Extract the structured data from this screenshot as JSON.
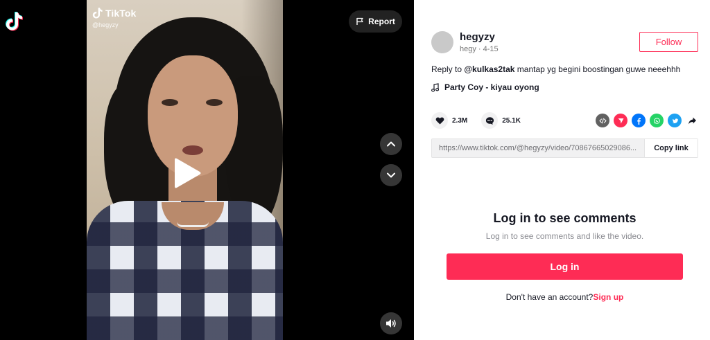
{
  "app": {
    "logo_icon": "tiktok-logo-icon"
  },
  "video": {
    "watermark_brand": "TikTok",
    "watermark_handle": "@hegyzy",
    "report_label": "Report",
    "is_paused": true
  },
  "author": {
    "username": "hegyzy",
    "nickname": "hegy",
    "separator": " · ",
    "date": "4-15",
    "follow_label": "Follow"
  },
  "caption": {
    "prefix": "Reply to ",
    "mention": "@kulkas2tak",
    "text": " mantap yg begini boostingan guwe neeehhh"
  },
  "music": {
    "title": "Party Coy - kiyau oyong"
  },
  "stats": {
    "likes": "2.3M",
    "comments": "25.1K"
  },
  "share": {
    "icons": [
      "embed-icon",
      "send-icon",
      "facebook-icon",
      "whatsapp-icon",
      "twitter-icon",
      "share-arrow-icon"
    ],
    "colors": {
      "embed": "#616161",
      "send": "#fe2c55",
      "facebook": "#0075fa",
      "whatsapp": "#25d366",
      "twitter": "#1da1f2"
    }
  },
  "link": {
    "url": "https://www.tiktok.com/@hegyzy/video/70867665029086...",
    "copy_label": "Copy link"
  },
  "login": {
    "title": "Log in to see comments",
    "subtitle": "Log in to see comments and like the video.",
    "button_label": "Log in",
    "signup_prompt": "Don't have an account?",
    "signup_label": "Sign up"
  },
  "colors": {
    "accent": "#fe2c55",
    "text": "#161823",
    "muted": "#757575"
  }
}
